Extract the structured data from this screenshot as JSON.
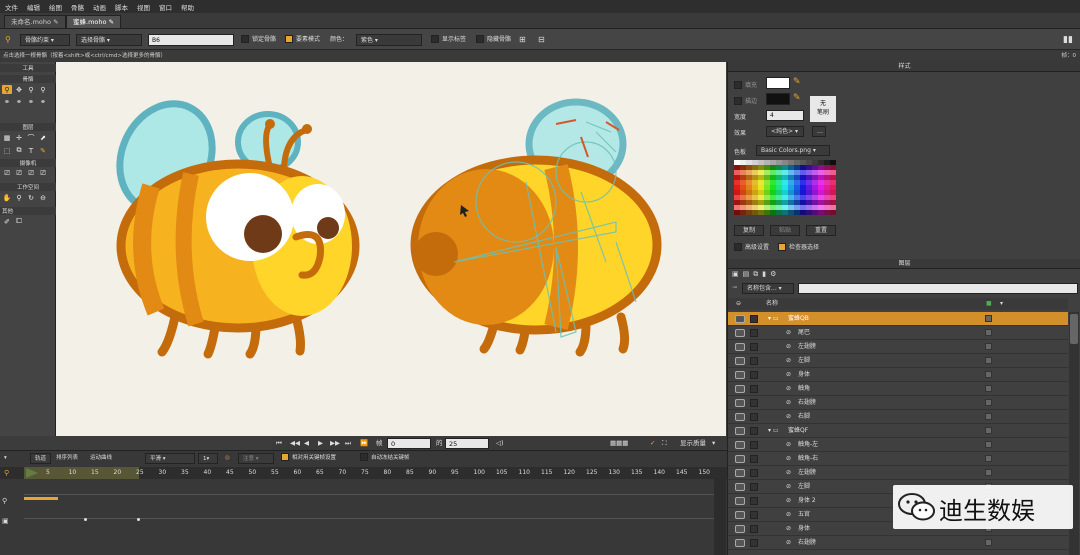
{
  "menu": [
    "文件",
    "编辑",
    "绘图",
    "骨骼",
    "动画",
    "脚本",
    "视图",
    "窗口",
    "帮助"
  ],
  "doc_tabs": [
    "未命名.moho",
    "蜜蜂.moho"
  ],
  "tool_options": {
    "mode_dropdown": "骨骼约束",
    "select_dropdown": "选择骨骼",
    "bone_name": "B6",
    "lock_bone_label": "锁定骨骼",
    "strength_label": "要素模式",
    "color_label": "颜色：",
    "color_value": "紫色",
    "show_label_label": "显示标签",
    "hide_bone_label": "隐藏骨骼"
  },
  "status_text": "点击选择一根骨骼（按着<shift>或<ctrl/cmd>选择更多的骨骼）",
  "frame_indicator": "帧：0",
  "tools_panel": {
    "title": "工具",
    "sections": [
      "骨骼",
      "图层",
      "摄像机",
      "工作空间",
      "其他"
    ]
  },
  "style_panel": {
    "title": "样式",
    "fill_label": "填充",
    "stroke_label": "描边",
    "width_label": "宽度",
    "width_value": "4",
    "effect_label": "效果",
    "effect_value": "<纯色>",
    "no_brush_label": "无\n笔刷",
    "swatches_label": "色板",
    "swatches_file": "Basic Colors.png",
    "copy_label": "复制",
    "paste_label": "粘贴",
    "reset_label": "重置",
    "advanced_label": "高级设置",
    "checker_label": "检查器选择",
    "colors": {
      "fill": "#ffffff",
      "stroke": "#111111"
    }
  },
  "layers_panel": {
    "title": "图层",
    "filter_dropdown": "名称包含...",
    "header_name": "名称",
    "rows": [
      {
        "name": "蜜蜂QB",
        "level": 0,
        "group": true
      },
      {
        "name": "尾巴",
        "level": 1
      },
      {
        "name": "左翅膀",
        "level": 1
      },
      {
        "name": "左脚",
        "level": 1
      },
      {
        "name": "身体",
        "level": 1
      },
      {
        "name": "触角",
        "level": 1
      },
      {
        "name": "右翅膀",
        "level": 1
      },
      {
        "name": "右脚",
        "level": 1
      },
      {
        "name": "蜜蜂QF",
        "level": 0,
        "group": true
      },
      {
        "name": "触角-左",
        "level": 1
      },
      {
        "name": "触角-右",
        "level": 1
      },
      {
        "name": "左翅膀",
        "level": 1
      },
      {
        "name": "左脚",
        "level": 1
      },
      {
        "name": "身体 2",
        "level": 1
      },
      {
        "name": "五官",
        "level": 1
      },
      {
        "name": "身体",
        "level": 1
      },
      {
        "name": "右翅膀",
        "level": 1
      }
    ]
  },
  "playback": {
    "frame_label": "帧",
    "frame_value": "0",
    "of_label": "的",
    "total_value": "25",
    "quality_label": "显示质量"
  },
  "timeline": {
    "tabs": [
      "轨道",
      "排序列表",
      "运动曲线"
    ],
    "interp_value": "平滑",
    "interp_count": "1",
    "ease_label": "注意",
    "relative_keys_label": "相对用关键帧设置",
    "auto_freeze_label": "自动冻结关键帧",
    "ruler": [
      "5",
      "10",
      "15",
      "20",
      "25",
      "30",
      "35",
      "40",
      "45",
      "50",
      "55",
      "60",
      "65",
      "70",
      "75",
      "80",
      "85",
      "90",
      "95",
      "100",
      "105",
      "110",
      "115",
      "120",
      "125",
      "130",
      "135",
      "140",
      "145",
      "150"
    ]
  },
  "watermark": {
    "text": "迪生数娱"
  }
}
